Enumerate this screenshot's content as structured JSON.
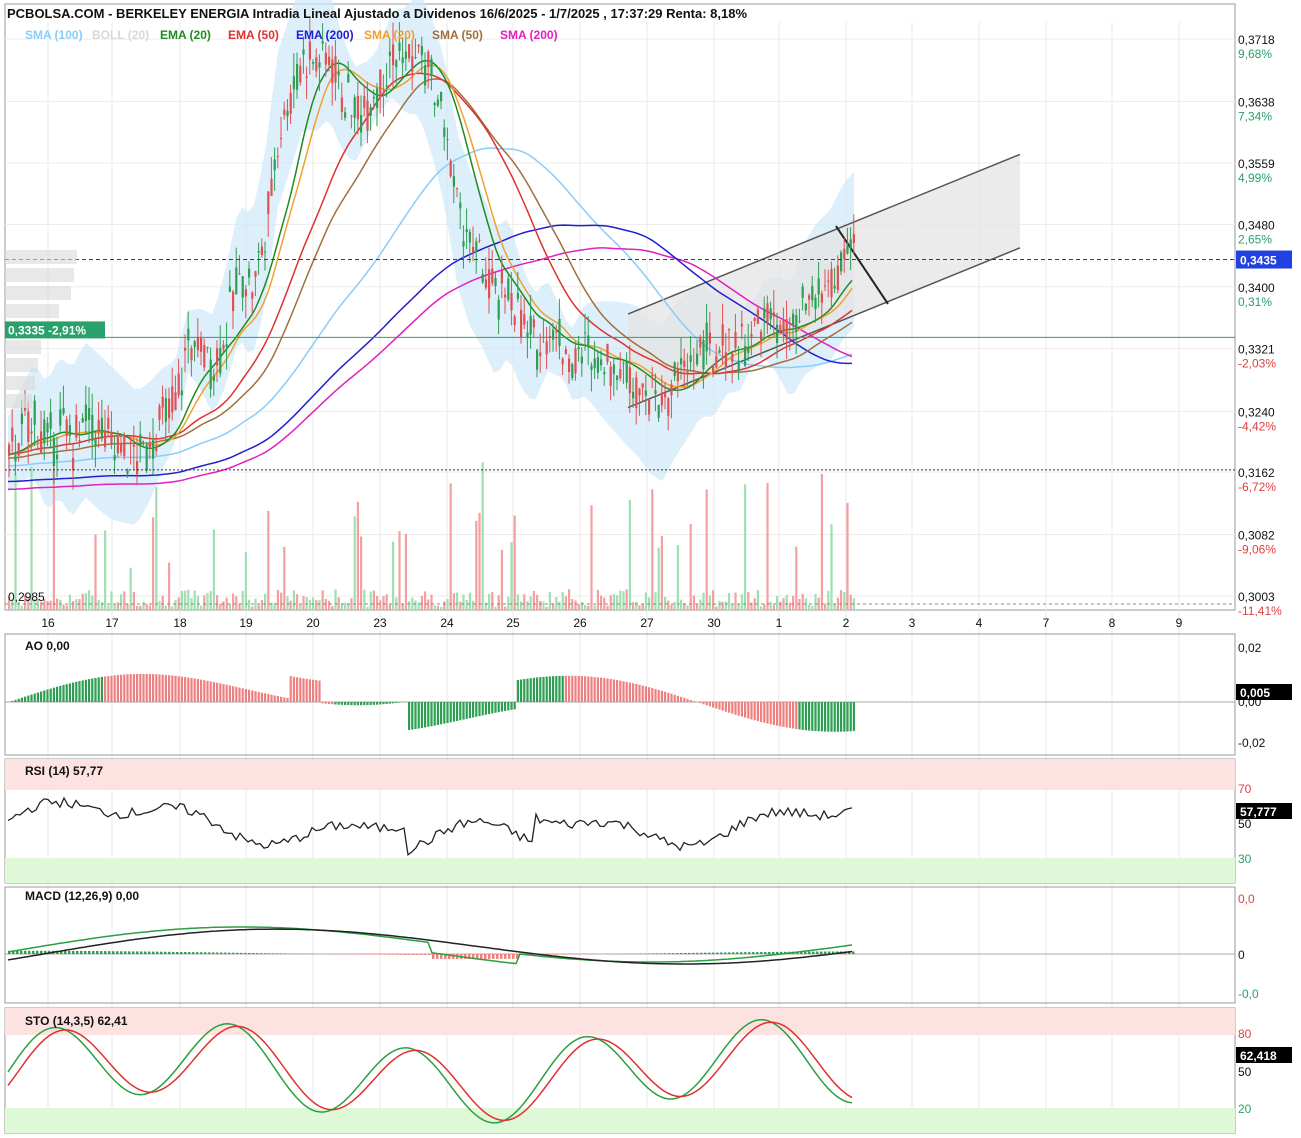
{
  "header": {
    "title": "PCBOLSA.COM - BERKELEY ENERGIA Intradia Lineal Ajustado a Dividenos 16/6/2025 - 1/7/2025 , 17:37:29 Renta: 8,18%"
  },
  "legend": [
    {
      "label": "SMA (100)",
      "color": "#87cefa"
    },
    {
      "label": "BOLL (20)",
      "color": "#d8d8d8"
    },
    {
      "label": "EMA (20)",
      "color": "#1e8c1e"
    },
    {
      "label": "EMA (50)",
      "color": "#e03030"
    },
    {
      "label": "EMA (200)",
      "color": "#2020d0"
    },
    {
      "label": "SMA (20)",
      "color": "#f0a030"
    },
    {
      "label": "SMA (50)",
      "color": "#a0703c"
    },
    {
      "label": "SMA (200)",
      "color": "#e020c0"
    }
  ],
  "price_axis": {
    "ticks": [
      {
        "value": "0,3718",
        "pct": "9,68%",
        "sign": "pos"
      },
      {
        "value": "0,3638",
        "pct": "7,34%",
        "sign": "pos"
      },
      {
        "value": "0,3559",
        "pct": "4,99%",
        "sign": "pos"
      },
      {
        "value": "0,3480",
        "pct": "2,65%",
        "sign": "pos"
      },
      {
        "value": "0,3400",
        "pct": "0,31%",
        "sign": "pos"
      },
      {
        "value": "0,3321",
        "pct": "-2,03%",
        "sign": "neg"
      },
      {
        "value": "0,3240",
        "pct": "-4,42%",
        "sign": "neg"
      },
      {
        "value": "0,3162",
        "pct": "-6,72%",
        "sign": "neg"
      },
      {
        "value": "0,3082",
        "pct": "-9,06%",
        "sign": "neg"
      },
      {
        "value": "0,3003",
        "pct": "-11,41%",
        "sign": "neg"
      }
    ],
    "last_price": "0,3435",
    "ref_price_label": "0,3335 -2,91%",
    "min_label": "0,2985"
  },
  "dates": [
    "16",
    "17",
    "18",
    "19",
    "20",
    "23",
    "24",
    "25",
    "26",
    "27",
    "30",
    "1",
    "2",
    "3",
    "4",
    "7",
    "8",
    "9"
  ],
  "indicators": {
    "ao": {
      "title": "AO  0,00",
      "ticks": [
        "0,02",
        "0,00",
        "-0,02"
      ],
      "current": "0,005"
    },
    "rsi": {
      "title": "RSI (14)   57,77",
      "ticks": [
        "70",
        "50",
        "30"
      ],
      "current": "57,777"
    },
    "macd": {
      "title": "MACD (12,26,9)   0,00",
      "ticks": [
        "0,0",
        "0",
        "-0,0"
      ]
    },
    "sto": {
      "title": "STO (14,3,5)   62,41",
      "ticks": [
        "80",
        "50",
        "20"
      ],
      "current": "62,418"
    }
  },
  "chart_data": {
    "type": "candlestick",
    "title": "PCBOLSA.COM - BERKELEY ENERGIA Intradia Lineal Ajustado a Dividenos 16/6/2025 - 1/7/2025 , 17:37:29 Renta: 8,18%",
    "x_categories": [
      "16",
      "17",
      "18",
      "19",
      "20",
      "23",
      "24",
      "25",
      "26",
      "27",
      "30",
      "1",
      "2"
    ],
    "ylim": [
      0.2985,
      0.374
    ],
    "close_path": [
      0.3185,
      0.321,
      0.323,
      0.3195,
      0.322,
      0.32,
      0.323,
      0.3215,
      0.32,
      0.319,
      0.318,
      0.32,
      0.323,
      0.325,
      0.333,
      0.332,
      0.33,
      0.335,
      0.342,
      0.34,
      0.347,
      0.36,
      0.365,
      0.37,
      0.369,
      0.37,
      0.365,
      0.362,
      0.364,
      0.367,
      0.37,
      0.369,
      0.37,
      0.366,
      0.36,
      0.35,
      0.345,
      0.342,
      0.338,
      0.34,
      0.335,
      0.332,
      0.335,
      0.333,
      0.33,
      0.332,
      0.331,
      0.33,
      0.329,
      0.328,
      0.326,
      0.325,
      0.328,
      0.33,
      0.332,
      0.331,
      0.333,
      0.332,
      0.334,
      0.336,
      0.335,
      0.333,
      0.337,
      0.339,
      0.34,
      0.343,
      0.345
    ],
    "channel": {
      "lower_start": 0.3245,
      "lower_end": 0.345,
      "upper_start": 0.3365,
      "upper_end": 0.357
    },
    "ref_lines": [
      0.3435,
      0.3335,
      0.3165
    ]
  }
}
